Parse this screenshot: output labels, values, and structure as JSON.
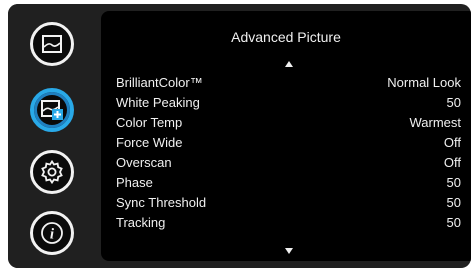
{
  "menu": {
    "title": "Advanced Picture",
    "items": [
      {
        "label": "BrilliantColor™",
        "value": "Normal Look"
      },
      {
        "label": "White Peaking",
        "value": "50"
      },
      {
        "label": "Color Temp",
        "value": "Warmest"
      },
      {
        "label": "Force Wide",
        "value": "Off"
      },
      {
        "label": "Overscan",
        "value": "Off"
      },
      {
        "label": "Phase",
        "value": "50"
      },
      {
        "label": "Sync Threshold",
        "value": "50"
      },
      {
        "label": "Tracking",
        "value": "50"
      }
    ]
  },
  "sidebar": {
    "icons": [
      "picture-icon",
      "advanced-picture-icon",
      "settings-gear-icon",
      "info-icon"
    ],
    "selected": "advanced-picture-icon"
  },
  "colors": {
    "selection_accent": "#29a9e8",
    "background": "#000000",
    "frame": "#202020",
    "text": "#f0f0f0"
  }
}
